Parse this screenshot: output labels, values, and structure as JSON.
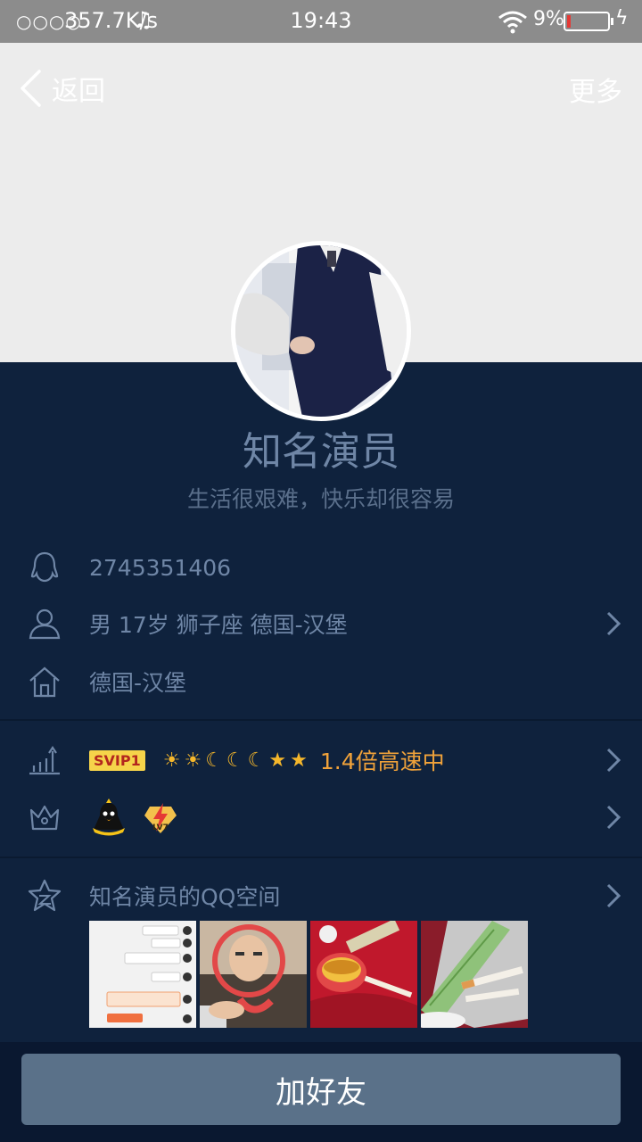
{
  "status_bar": {
    "signal": "○○○○",
    "speed": "357.7K/s",
    "time": "19:43",
    "battery_pct": "9%",
    "battery_level": 0.09,
    "music_icon": "music-note-icon",
    "charging_icon": "charging-bolt-icon"
  },
  "nav": {
    "back_label": "返回",
    "more_label": "更多"
  },
  "profile": {
    "nickname": "知名演员",
    "signature": "生活很艰难，快乐却很容易"
  },
  "info": {
    "qq_number": "2745351406",
    "details": "男  17岁  狮子座  德国-汉堡",
    "hometown": "德国-汉堡"
  },
  "vip": {
    "badge": "SVIP1",
    "level_icons": [
      "sun-icon",
      "sun-icon",
      "moon-icon",
      "moon-icon",
      "moon-icon",
      "star-icon",
      "star-icon"
    ],
    "speed": "1.4倍高速中"
  },
  "badges": {
    "icons": [
      "qq-penguin-icon",
      "lightning-lv7-icon"
    ]
  },
  "qzone": {
    "title": "知名演员的QQ空间"
  },
  "actions": {
    "add_friend": "加好友"
  },
  "colors": {
    "background": "#0f223d",
    "text": "#6f86a6",
    "accent": "#f0a23a",
    "button": "#5a7189"
  }
}
